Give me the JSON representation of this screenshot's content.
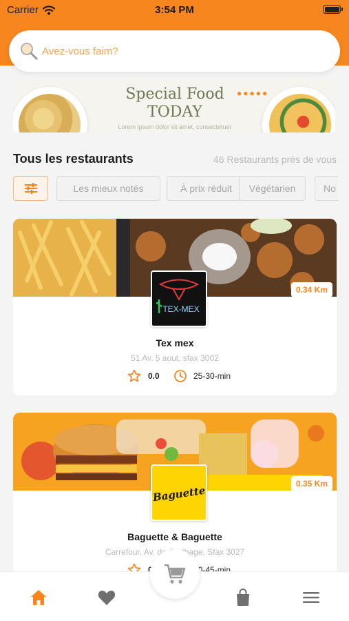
{
  "status_bar": {
    "carrier": "Carrier",
    "time": "3:54 PM"
  },
  "search": {
    "placeholder": "Avez-vous faim?"
  },
  "banner": {
    "title_line1": "Special Food",
    "title_line2": "TODAY",
    "subtitle": "Lorem ipsum dolor sit amet, consectetuer"
  },
  "section": {
    "title": "Tous les restaurants",
    "count": "46 Restaurants près de vous"
  },
  "filters": [
    "Les mieux notés",
    "À prix réduit",
    "Végétarien",
    "No"
  ],
  "restaurants": [
    {
      "name": "Tex mex",
      "address": "51 Av. 5 aout, sfax 3002",
      "rating": "0.0",
      "time": "25-30-min",
      "distance": "0.34 Km",
      "logo_text": "TEX-MEX"
    },
    {
      "name": "Baguette & Baguette",
      "address": "Carrefour, Av. de Carthage, Sfax 3027",
      "rating": "0.0",
      "time": "40-45-min",
      "distance": "0.35 Km",
      "logo_text": "Baguette"
    }
  ],
  "colors": {
    "accent": "#f7861e",
    "background": "#f4f4f4"
  },
  "tabbar": {
    "icons": [
      "home-icon",
      "heart-icon",
      "cart-icon",
      "bag-icon",
      "menu-icon"
    ]
  }
}
